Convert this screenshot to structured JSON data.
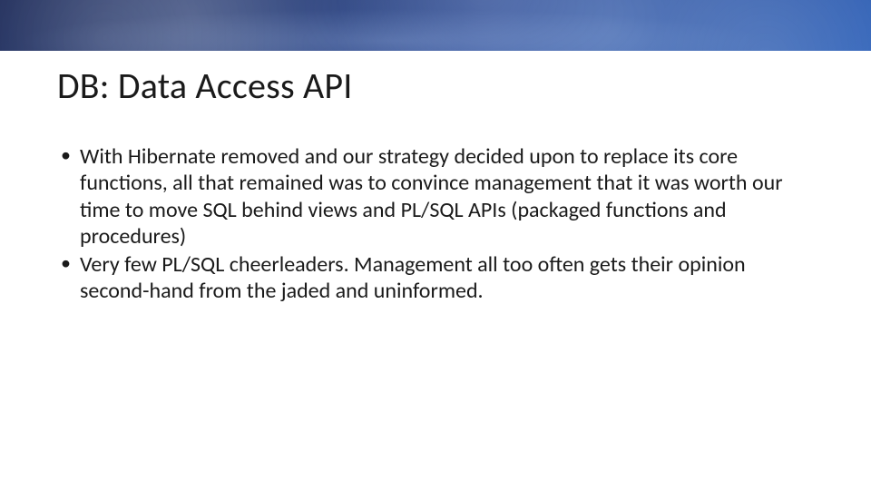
{
  "title": "DB: Data Access API",
  "bullets": [
    "With Hibernate removed and our strategy decided upon to replace its core functions, all that remained was to convince management that it was worth our time to move SQL behind views and PL/SQL APIs (packaged functions and procedures)",
    "Very few PL/SQL cheerleaders. Management all too often gets their opinion second-hand from the jaded and uninformed."
  ]
}
